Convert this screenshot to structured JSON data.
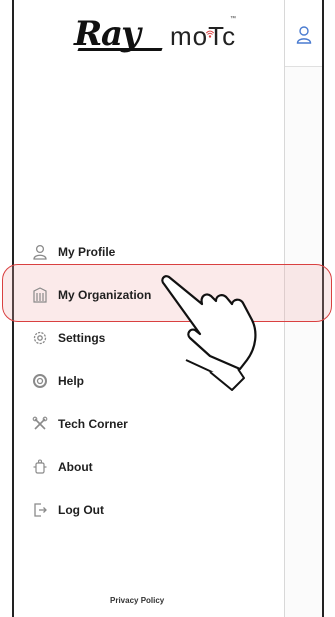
{
  "logo": {
    "brand_primary": "Ray",
    "brand_secondary": "moTc",
    "trademark": "™"
  },
  "menu": {
    "items": [
      {
        "label": "My Profile",
        "icon": "user-icon"
      },
      {
        "label": "My Organization",
        "icon": "building-icon"
      },
      {
        "label": "Settings",
        "icon": "gear-icon"
      },
      {
        "label": "Help",
        "icon": "lifebuoy-icon"
      },
      {
        "label": "Tech Corner",
        "icon": "tools-icon"
      },
      {
        "label": "About",
        "icon": "about-icon"
      },
      {
        "label": "Log Out",
        "icon": "logout-icon"
      }
    ],
    "selected": "My Organization"
  },
  "footer": {
    "privacy_label": "Privacy Policy"
  },
  "colors": {
    "highlight_border": "#d94040",
    "icon_gray": "#8a8a8a",
    "accent_blue": "#4a7bd0"
  }
}
